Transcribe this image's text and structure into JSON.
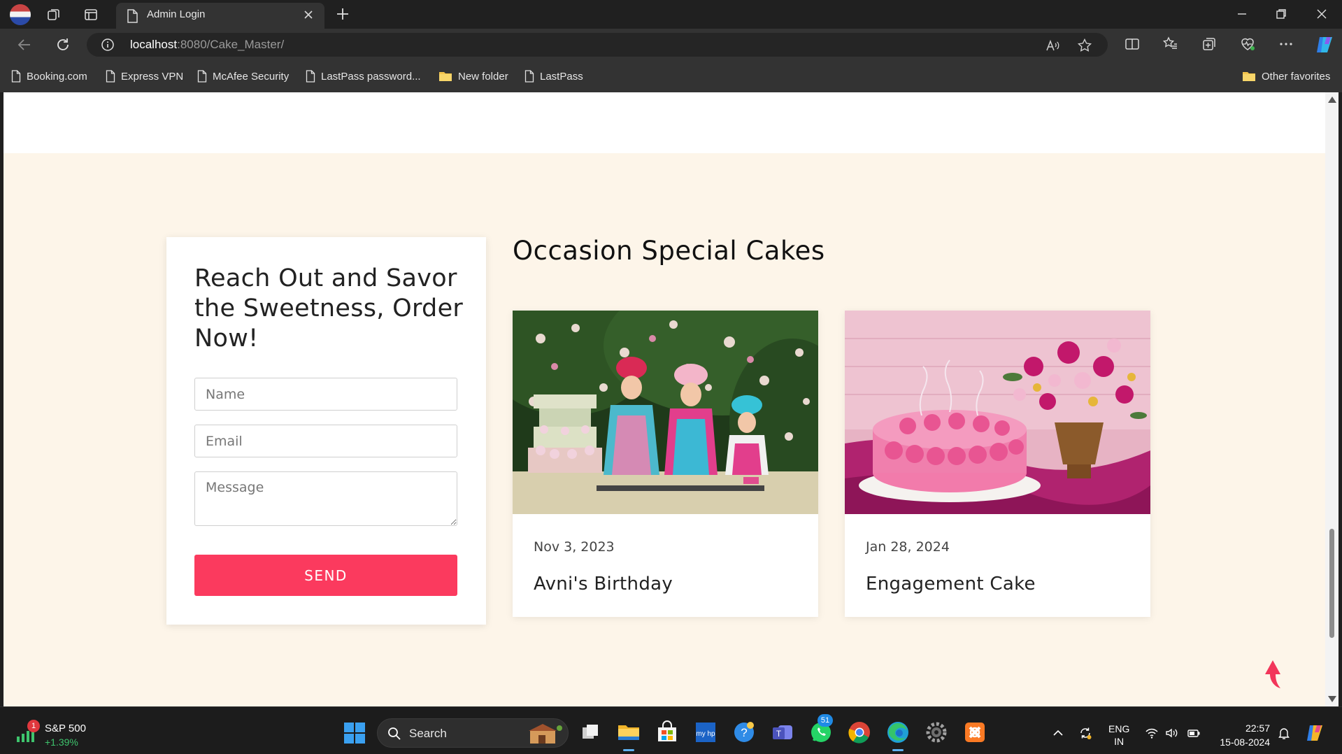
{
  "browser": {
    "tab_title": "Admin Login",
    "url_host": "localhost",
    "url_path": ":8080/Cake_Master/",
    "favorites": [
      {
        "label": "Booking.com",
        "icon": "page-icon"
      },
      {
        "label": "Express VPN",
        "icon": "page-icon"
      },
      {
        "label": "McAfee Security",
        "icon": "page-icon"
      },
      {
        "label": "LastPass password...",
        "icon": "page-icon"
      },
      {
        "label": "New folder",
        "icon": "folder-icon"
      },
      {
        "label": "LastPass",
        "icon": "page-icon"
      }
    ],
    "other_favorites": "Other favorites"
  },
  "contact": {
    "title": "Reach Out and Savor the Sweetness, Order Now!",
    "name_placeholder": "Name",
    "email_placeholder": "Email",
    "message_placeholder": "Message",
    "send_label": "SEND"
  },
  "occasions": {
    "title": "Occasion Special Cakes",
    "cards": [
      {
        "date": "Nov 3, 2023",
        "name": "Avni's Birthday",
        "image": "kids-baking-cake-photo"
      },
      {
        "date": "Jan 28, 2024",
        "name": "Engagement Cake",
        "image": "pink-rose-cake-photo"
      }
    ]
  },
  "taskbar": {
    "stock_name": "S&P 500",
    "stock_change": "+1.39%",
    "stock_badge": "1",
    "search_label": "Search",
    "whatsapp_badge": "51",
    "lang_line1": "ENG",
    "lang_line2": "IN",
    "time": "22:57",
    "date": "15-08-2024"
  },
  "colors": {
    "accent": "#fb3a5e",
    "page_bg": "#fdf5e9",
    "chrome_bg": "#333333"
  }
}
